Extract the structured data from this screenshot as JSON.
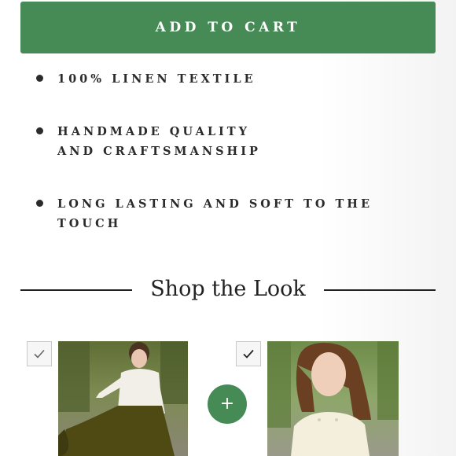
{
  "cart": {
    "button_label": "ADD TO CART"
  },
  "features": [
    "100% LINEN TEXTILE",
    "HANDMADE QUALITY AND CRAFTSMANSHIP",
    "LONG LASTING AND SOFT TO THE TOUCH"
  ],
  "shop_the_look": {
    "title": "Shop the Look",
    "add_symbol": "+",
    "products": [
      {
        "checked": true,
        "icon": "checkmark-icon"
      },
      {
        "checked": true,
        "icon": "checkmark-icon"
      }
    ]
  },
  "colors": {
    "accent": "#468a55",
    "text": "#2b2b2b"
  }
}
